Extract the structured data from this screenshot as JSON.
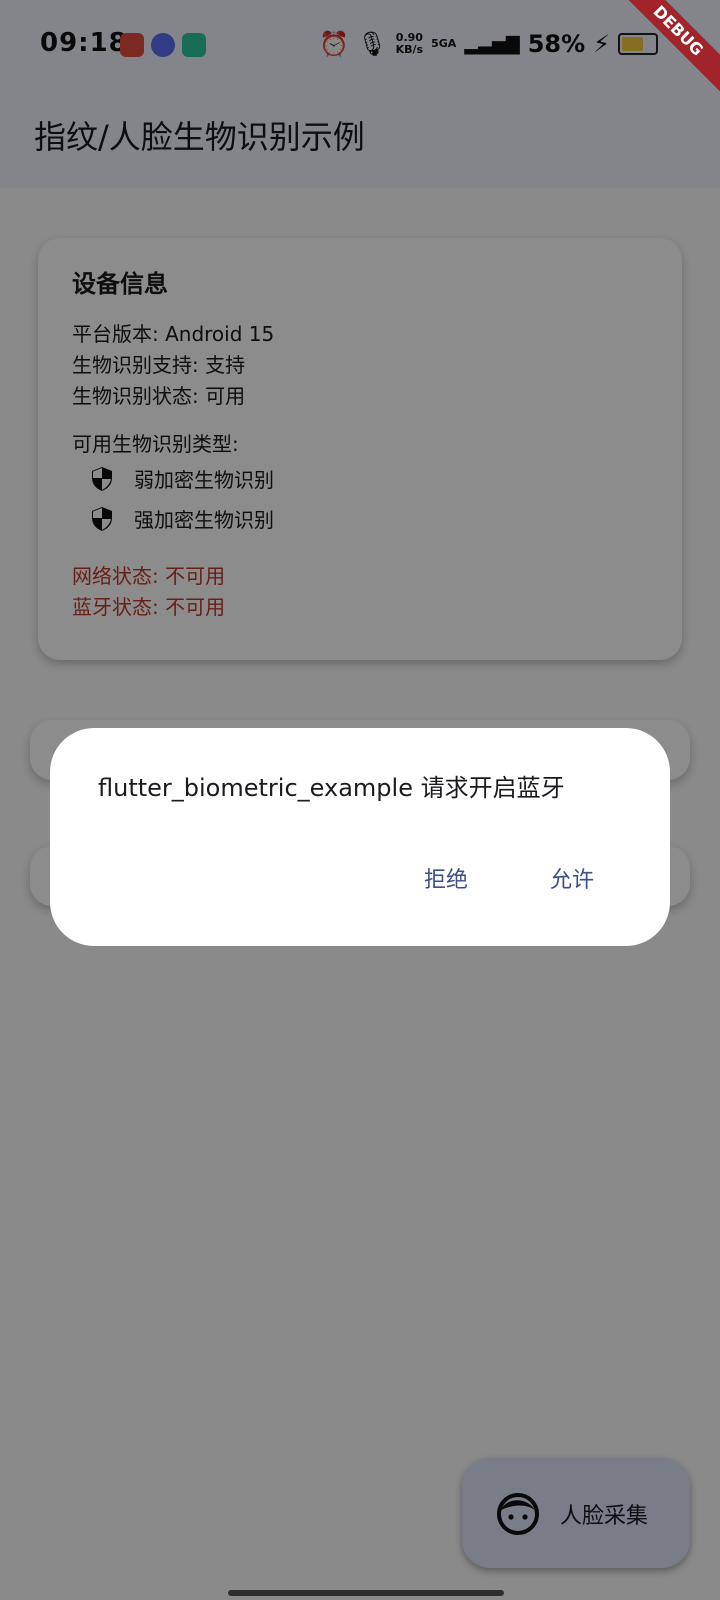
{
  "status_bar": {
    "time": "09:18",
    "network_speed_value": "0.90",
    "network_speed_unit": "KB/s",
    "network_type": "5GA",
    "battery_percent": "58%",
    "battery_level": 0.58
  },
  "debug_banner": "DEBUG",
  "app_bar": {
    "title": "指纹/人脸生物识别示例"
  },
  "device_card": {
    "title": "设备信息",
    "platform": "平台版本: Android 15",
    "support": "生物识别支持: 支持",
    "status": "生物识别状态: 可用",
    "types_header": "可用生物识别类型:",
    "types": [
      "弱加密生物识别",
      "强加密生物识别"
    ],
    "network": "网络状态: 不可用",
    "bluetooth": "蓝牙状态: 不可用"
  },
  "fab": {
    "label": "人脸采集",
    "icon": "face-icon"
  },
  "dialog": {
    "message": "flutter_biometric_example 请求开启蓝牙",
    "deny_label": "拒绝",
    "allow_label": "允许"
  },
  "colors": {
    "accent": "#3b4f8a",
    "error": "#c0392b",
    "appbar_bg": "#eef2fb",
    "fab_bg": "#dbe3f8"
  }
}
